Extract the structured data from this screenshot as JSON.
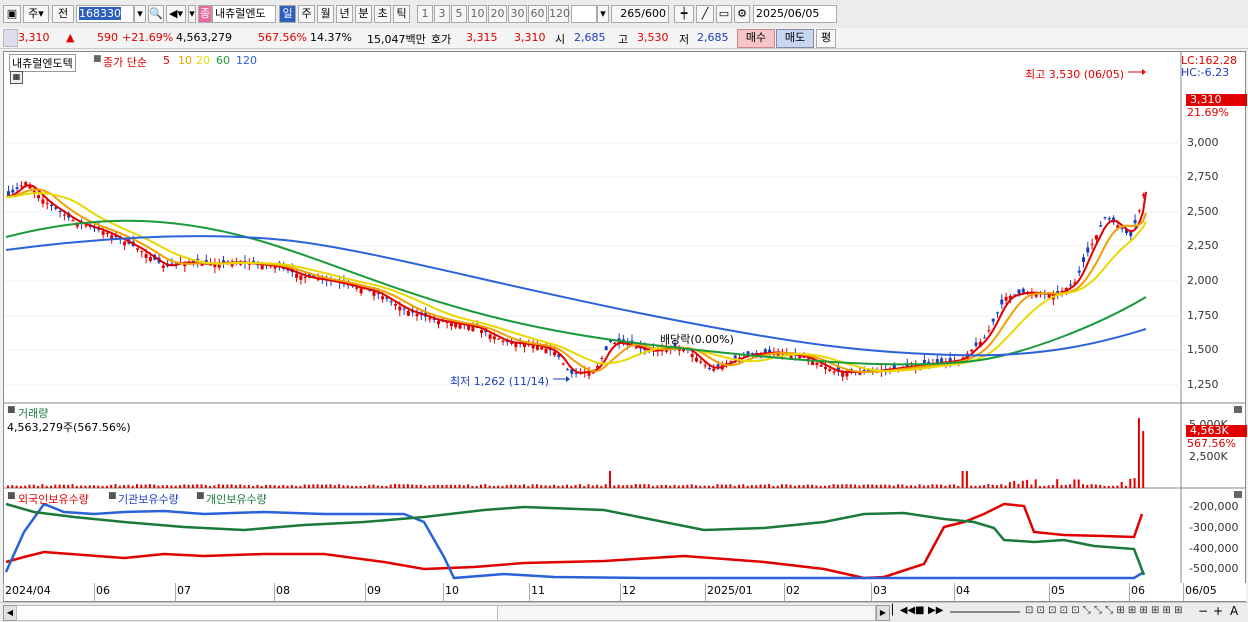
{
  "toolbar": {
    "market": "주",
    "prev": "전",
    "code": "168330",
    "sound_icon": "speaker-icon",
    "name_badge": "종",
    "name": "내츄럴엔도",
    "periods": [
      "일",
      "주",
      "월",
      "년",
      "분",
      "초",
      "틱"
    ],
    "active_period": "일",
    "intervals": [
      "1",
      "3",
      "5",
      "10",
      "20",
      "30",
      "60",
      "120"
    ],
    "count_display": "265",
    "count_total": "/600",
    "date": "2025/06/05"
  },
  "quote": {
    "price": "3,310",
    "updown_icon": "▲",
    "change": "590",
    "change_pct": "+21.69%",
    "volume": "4,563,279",
    "volume_pct": "567.56%",
    "turnover": "14.37%",
    "amount": "15,047백만",
    "ask_label": "호가",
    "ask": "3,315",
    "bid": "3,310",
    "open_label": "시",
    "open": "2,685",
    "high_label": "고",
    "high": "3,530",
    "low_label": "저",
    "low": "2,685",
    "buy": "매수",
    "sell": "매도",
    "eval": "평"
  },
  "legend": {
    "stock": "내츄럴엔도텍",
    "ma_title": "종가 단순",
    "ma": [
      {
        "label": "5",
        "color": "#e00000"
      },
      {
        "label": "10",
        "color": "#f0a000"
      },
      {
        "label": "20",
        "color": "#e8d800"
      },
      {
        "label": "60",
        "color": "#1a9a3a"
      },
      {
        "label": "120",
        "color": "#2a62d8"
      }
    ]
  },
  "price_panel": {
    "lc": "LC:162.28",
    "hc": "HC:-6.23",
    "current_tag": "3,310",
    "current_pct": "21.69%",
    "yticks": [
      "3,000",
      "2,750",
      "2,500",
      "2,250",
      "2,000",
      "1,750",
      "1,500",
      "1,250"
    ],
    "high_note": "최고 3,530 (06/05)",
    "low_note": "최저 1,262 (11/14)",
    "dividend_note": "배당락(0.00%)"
  },
  "volume_panel": {
    "title": "거래량",
    "value": "4,563,279주(567.56%)",
    "tag": "4,563K",
    "tag_pct": "567.56%",
    "top_tick": "5,000K",
    "yticks": [
      "2,500K"
    ]
  },
  "holding_panel": {
    "series": [
      {
        "name": "외국인보유수량",
        "color": "#e00000"
      },
      {
        "name": "기관보유수량",
        "color": "#1a3fbf"
      },
      {
        "name": "개인보유수량",
        "color": "#1a7a3a"
      }
    ],
    "yticks": [
      "-200,000",
      "-300,000",
      "-400,000",
      "-500,000"
    ]
  },
  "xaxis": [
    "2024/04",
    "06",
    "07",
    "08",
    "09",
    "10",
    "11",
    "12",
    "2025/01",
    "02",
    "03",
    "04",
    "05",
    "06",
    "06/05"
  ]
}
